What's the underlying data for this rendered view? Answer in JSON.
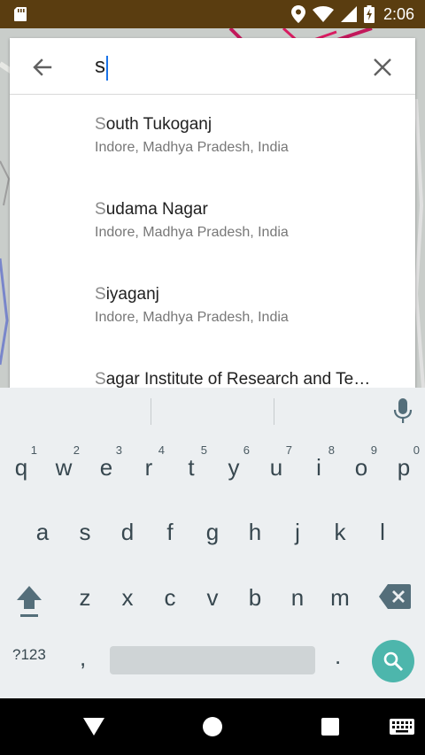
{
  "status_bar": {
    "time": "2:06",
    "icons": [
      "sd-card-icon",
      "location-icon",
      "wifi-icon",
      "signal-icon",
      "battery-charging-icon"
    ]
  },
  "search": {
    "query": "s",
    "back_icon": "arrow-left-icon",
    "clear_icon": "close-icon"
  },
  "results": [
    {
      "highlight": "S",
      "rest": "outh Tukoganj",
      "subtitle": "Indore, Madhya Pradesh, India"
    },
    {
      "highlight": "S",
      "rest": "udama Nagar",
      "subtitle": "Indore, Madhya Pradesh, India"
    },
    {
      "highlight": "S",
      "rest": "iyaganj",
      "subtitle": "Indore, Madhya Pradesh, India"
    },
    {
      "highlight": "S",
      "rest": "agar Institute of Research and Te…",
      "subtitle": ""
    }
  ],
  "keyboard": {
    "row1": [
      {
        "k": "q",
        "n": "1"
      },
      {
        "k": "w",
        "n": "2"
      },
      {
        "k": "e",
        "n": "3"
      },
      {
        "k": "r",
        "n": "4"
      },
      {
        "k": "t",
        "n": "5"
      },
      {
        "k": "y",
        "n": "6"
      },
      {
        "k": "u",
        "n": "7"
      },
      {
        "k": "i",
        "n": "8"
      },
      {
        "k": "o",
        "n": "9"
      },
      {
        "k": "p",
        "n": "0"
      }
    ],
    "row2": [
      "a",
      "s",
      "d",
      "f",
      "g",
      "h",
      "j",
      "k",
      "l"
    ],
    "row3": [
      "z",
      "x",
      "c",
      "v",
      "b",
      "n",
      "m"
    ],
    "symbols_label": "?123",
    "comma": ",",
    "period": ".",
    "accent_color": "#4db6ac"
  },
  "colors": {
    "status_bar": "#5a3d10",
    "keyboard_bg": "#eceff1",
    "nav_bar": "#000000"
  }
}
